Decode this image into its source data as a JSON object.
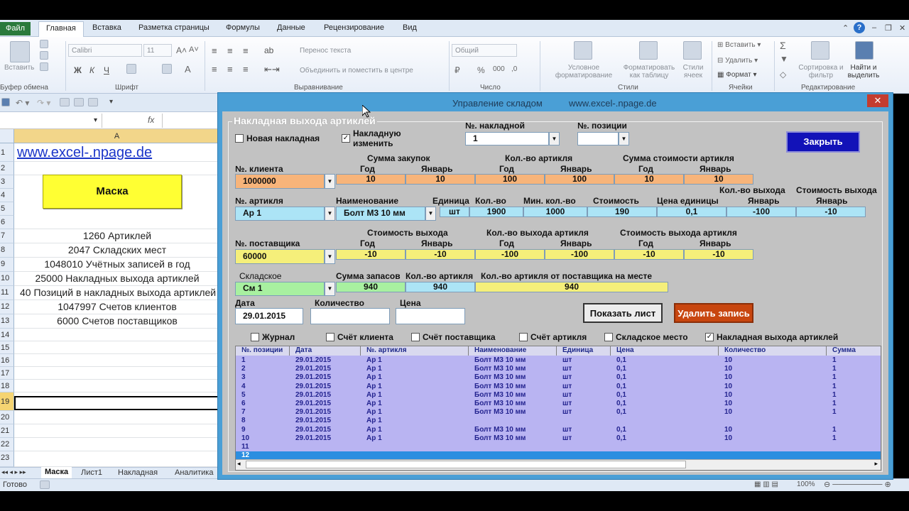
{
  "ribbon": {
    "tabs": [
      "Файл",
      "Главная",
      "Вставка",
      "Разметка страницы",
      "Формулы",
      "Данные",
      "Рецензирование",
      "Вид"
    ],
    "paste": "Вставить",
    "font_name": "Calibri",
    "font_size": "11",
    "wrap_text": "Перенос текста",
    "merge_center": "Объединить и поместить в центре",
    "number_format": "Общий",
    "cond_format": "Условное форматирование",
    "format_table": "Форматировать как таблицу",
    "cell_styles": "Стили ячеек",
    "insert": "Вставить",
    "delete": "Удалить",
    "format": "Формат",
    "sort_filter": "Сортировка и фильтр",
    "find_select": "Найти и выделить",
    "groups": [
      "Буфер обмена",
      "Шрифт",
      "Выравнивание",
      "Число",
      "Стили",
      "Ячейки",
      "Редактирование"
    ]
  },
  "formula_bar": {
    "fx": "fx"
  },
  "sheet": {
    "column": "A",
    "rows": [
      "1",
      "2",
      "3",
      "4",
      "5",
      "6",
      "7",
      "8",
      "9",
      "10",
      "11",
      "12",
      "13",
      "14",
      "15",
      "16",
      "17",
      "18",
      "19",
      "20",
      "21",
      "22",
      "23"
    ],
    "link": "www.excel-.npage.de",
    "mask_button": "Маска",
    "stats": [
      "1260 Артиклей",
      "2047 Складских мест",
      "1048010 Учётных записей в год",
      "25000 Накладных выхода артиклей",
      "40 Позиций в накладных выхода артиклей",
      "1047997 Счетов клиентов",
      "6000 Счетов поставщиков"
    ],
    "tabs": [
      "Маска",
      "Лист1",
      "Накладная",
      "Аналитика"
    ],
    "status": "Готово",
    "zoom": "100%"
  },
  "dialog": {
    "title": "Управление складом",
    "url": "www.excel-.npage.de",
    "close_x": "✕",
    "frame_title": "Накладная выхода артиклей",
    "new_invoice": "Новая накладная",
    "edit_invoice": "Накладную изменить",
    "invoice_no_label": "№. накладной",
    "invoice_no": "1",
    "position_no_label": "№. позиции",
    "close_button": "Закрыть",
    "purchase_sum": "Сумма закупок",
    "article_qty": "Кол.-во артикля",
    "article_value_sum": "Сумма стоимости артикля",
    "year": "Год",
    "january": "Январь",
    "client_no_label": "№. клиента",
    "client_no": "1000000",
    "row1": [
      "10",
      "10",
      "100",
      "100",
      "10",
      "10"
    ],
    "article_no_label": "№. артикля",
    "article_no": "Ар 1",
    "name_label": "Наименование",
    "name": "Болт М3 10 мм",
    "unit_label": "Единица",
    "unit": "шт",
    "qty_label": "Кол.-во",
    "qty": "1900",
    "min_qty_label": "Мин. кол.-во",
    "min_qty": "1000",
    "value_label": "Стоимость",
    "value": "190",
    "unit_price_label": "Цена единицы",
    "unit_price": "0,1",
    "out_qty_label": "Кол.-во выхода",
    "out_qty_jan": "-100",
    "out_value_label": "Стоимость выхода",
    "out_value_jan": "-10",
    "supplier_no_label": "№. поставщика",
    "supplier_no": "60000",
    "out_value2": "Стоимость выхода",
    "out_article_qty": "Кол.-во выхода артикля",
    "out_article_value": "Стоимость выхода артикля",
    "row3": [
      "-10",
      "-10",
      "-100",
      "-100",
      "-10",
      "-10"
    ],
    "storage_label": "Складское",
    "storage": "См 1",
    "stock_sum_label": "Сумма запасов",
    "stock_sum": "940",
    "article_qty2_label": "Кол.-во артикля",
    "article_qty2": "940",
    "supplier_qty_label": "Кол.-во артикля от поставщика на месте",
    "supplier_qty": "940",
    "date_label": "Дата",
    "date": "29.01.2015",
    "quantity_label": "Количество",
    "price_label": "Цена",
    "show_sheet": "Показать лист",
    "delete_record": "Удалить запись",
    "filters": [
      "Журнал",
      "Счёт клиента",
      "Счёт поставщика",
      "Счёт артикля",
      "Складское место",
      "Накладная выхода артиклей"
    ],
    "filter_checked": [
      false,
      false,
      false,
      false,
      false,
      true
    ],
    "list_headers": [
      "№. позиции",
      "Дата",
      "№. артикля",
      "Наименование",
      "Единица",
      "Цена",
      "Количество",
      "Сумма"
    ],
    "list_rows": [
      [
        "1",
        "29.01.2015",
        "Ар 1",
        "Болт М3 10 мм",
        "шт",
        "0,1",
        "10",
        "1"
      ],
      [
        "2",
        "29.01.2015",
        "Ар 1",
        "Болт М3 10 мм",
        "шт",
        "0,1",
        "10",
        "1"
      ],
      [
        "3",
        "29.01.2015",
        "Ар 1",
        "Болт М3 10 мм",
        "шт",
        "0,1",
        "10",
        "1"
      ],
      [
        "4",
        "29.01.2015",
        "Ар 1",
        "Болт М3 10 мм",
        "шт",
        "0,1",
        "10",
        "1"
      ],
      [
        "5",
        "29.01.2015",
        "Ар 1",
        "Болт М3 10 мм",
        "шт",
        "0,1",
        "10",
        "1"
      ],
      [
        "6",
        "29.01.2015",
        "Ар 1",
        "Болт М3 10 мм",
        "шт",
        "0,1",
        "10",
        "1"
      ],
      [
        "7",
        "29.01.2015",
        "Ар 1",
        "Болт М3 10 мм",
        "шт",
        "0,1",
        "10",
        "1"
      ],
      [
        "8",
        "29.01.2015",
        "Ар 1",
        "",
        "",
        "",
        "",
        ""
      ],
      [
        "9",
        "29.01.2015",
        "Ар 1",
        "Болт М3 10 мм",
        "шт",
        "0,1",
        "10",
        "1"
      ],
      [
        "10",
        "29.01.2015",
        "Ар 1",
        "Болт М3 10 мм",
        "шт",
        "0,1",
        "10",
        "1"
      ],
      [
        "11",
        "",
        "",
        "",
        "",
        "",
        "",
        ""
      ],
      [
        "12",
        "",
        "",
        "",
        "",
        "",
        "",
        ""
      ]
    ]
  }
}
